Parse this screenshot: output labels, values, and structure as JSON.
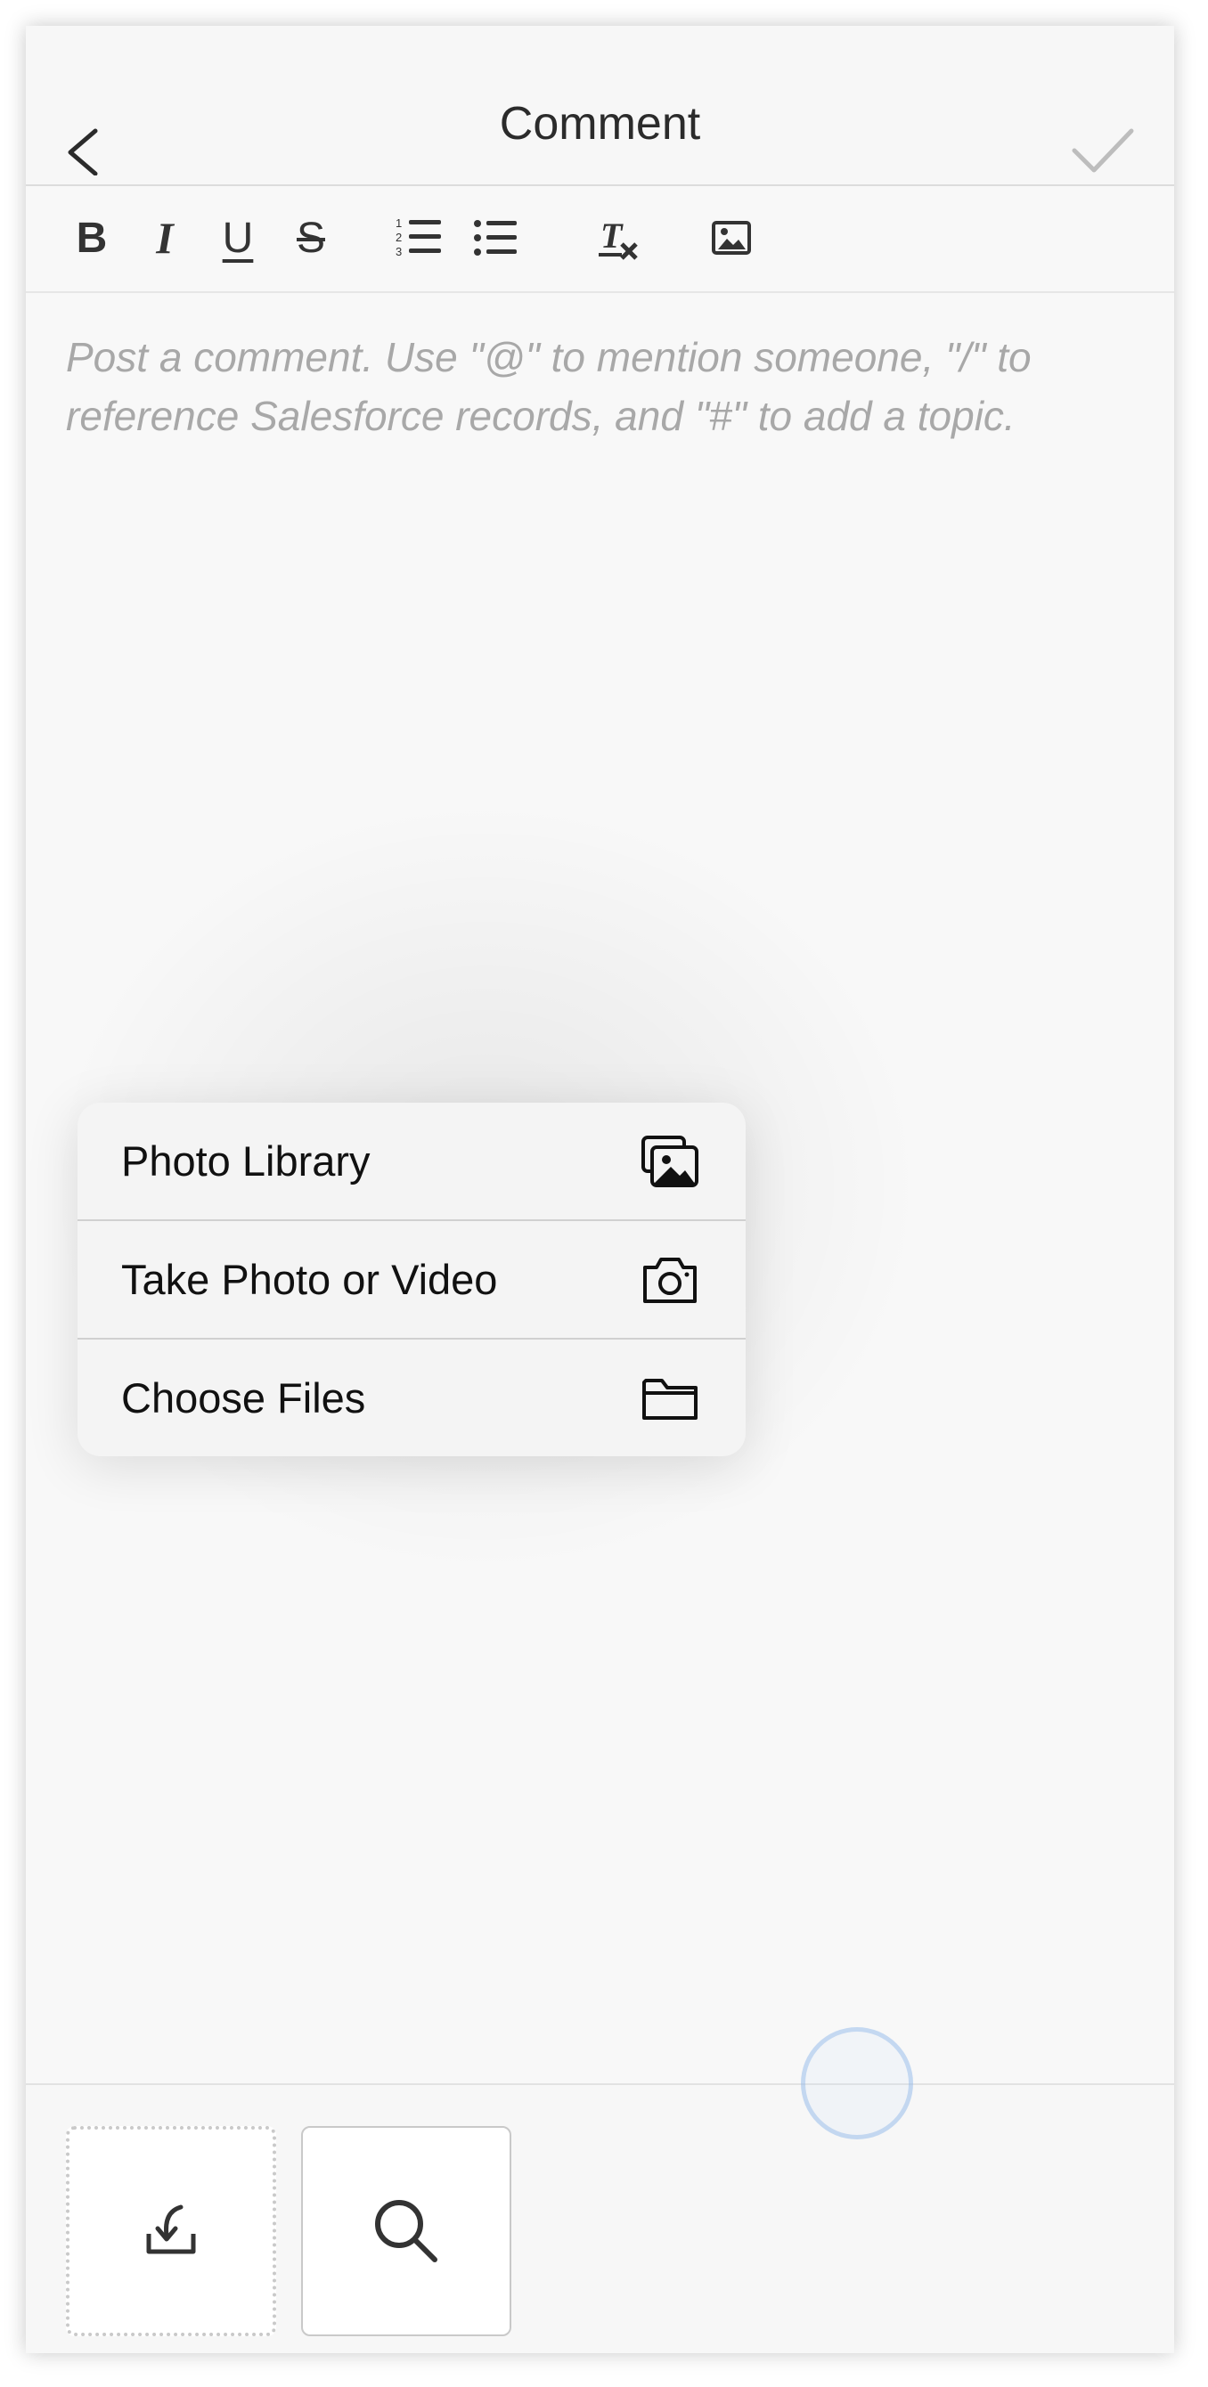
{
  "nav": {
    "title": "Comment",
    "back_icon": "chevron-left-icon",
    "done_icon": "checkmark-icon"
  },
  "toolbar": {
    "bold": "B",
    "italic": "I",
    "underline": "U",
    "strikethrough": "S",
    "icons": [
      "numbered-list-icon",
      "bulleted-list-icon",
      "clear-format-icon",
      "image-icon"
    ]
  },
  "editor": {
    "placeholder": "Post a comment. Use \"@\" to mention someone, \"/\" to reference Salesforce records, and \"#\" to add a topic."
  },
  "menu": {
    "items": [
      {
        "label": "Photo Library",
        "icon": "photo-library-icon"
      },
      {
        "label": "Take Photo or Video",
        "icon": "camera-icon"
      },
      {
        "label": "Choose Files",
        "icon": "folder-icon"
      }
    ]
  },
  "bottom": {
    "tiles": [
      "upload-icon",
      "search-icon"
    ]
  },
  "colors": {
    "text": "#2b2b2b",
    "placeholder": "#a8a8a8",
    "checkmark_disabled": "#bdbdbd",
    "touch_indicator": "#8cb4e6"
  }
}
